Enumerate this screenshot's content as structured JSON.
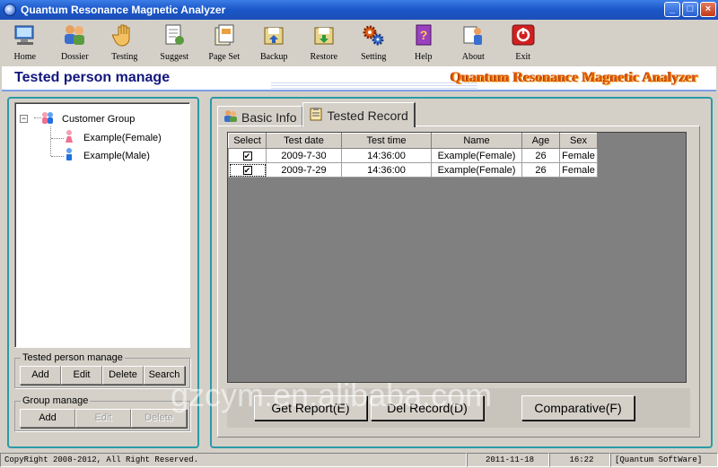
{
  "window": {
    "title": "Quantum Resonance Magnetic Analyzer",
    "minimize": "_",
    "maximize": "□",
    "close": "×"
  },
  "toolbar": [
    {
      "label": "Home",
      "icon": "home-computer-icon"
    },
    {
      "label": "Dossier",
      "icon": "people-icon"
    },
    {
      "label": "Testing",
      "icon": "hand-icon"
    },
    {
      "label": "Suggest",
      "icon": "document-icon"
    },
    {
      "label": "Page Set",
      "icon": "page-setup-icon"
    },
    {
      "label": "Backup",
      "icon": "backup-icon"
    },
    {
      "label": "Restore",
      "icon": "restore-icon"
    },
    {
      "label": "Setting",
      "icon": "gears-icon"
    },
    {
      "label": "Help",
      "icon": "help-book-icon"
    },
    {
      "label": "About",
      "icon": "about-icon"
    },
    {
      "label": "Exit",
      "icon": "power-icon"
    }
  ],
  "header": {
    "title": "Tested person manage",
    "brand": "Quantum Resonance Magnetic Analyzer"
  },
  "tree": {
    "root": "Customer Group",
    "children": [
      "Example(Female)",
      "Example(Male)"
    ]
  },
  "tested_person_manage": {
    "legend": "Tested person manage",
    "buttons": [
      "Add",
      "Edit",
      "Delete",
      "Search"
    ]
  },
  "group_manage": {
    "legend": "Group manage",
    "buttons": [
      "Add",
      "Edit",
      "Delete"
    ]
  },
  "tabs": [
    "Basic Info",
    "Tested Record"
  ],
  "records": {
    "columns": [
      "Select",
      "Test date",
      "Test time",
      "Name",
      "Age",
      "Sex"
    ],
    "rows": [
      {
        "checked": "✔",
        "date": "2009-7-30",
        "time": "14:36:00",
        "name": "Example(Female)",
        "age": "26",
        "sex": "Female"
      },
      {
        "checked": "✔",
        "date": "2009-7-29",
        "time": "14:36:00",
        "name": "Example(Female)",
        "age": "26",
        "sex": "Female"
      }
    ]
  },
  "actions": {
    "get_report": "Get Report(E)",
    "del_record": "Del Record(D)",
    "comparative": "Comparative(F)"
  },
  "watermark": "gzcym.en.alibaba.com",
  "status": {
    "copyright": "CopyRight 2008-2012, All Right Reserved.",
    "date": "2011-11-18",
    "time": "16:22",
    "software": "[Quantum SoftWare]"
  }
}
